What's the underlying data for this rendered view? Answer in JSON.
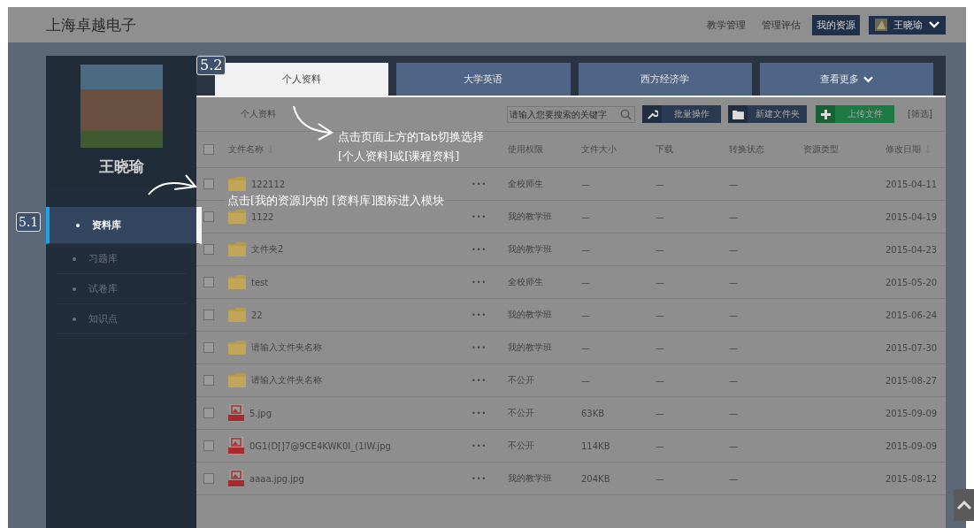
{
  "header": {
    "title": "上海卓越电子",
    "nav": [
      {
        "label": "教学管理",
        "selected": false
      },
      {
        "label": "管理评估",
        "selected": false
      },
      {
        "label": "我的资源",
        "selected": true
      }
    ],
    "user": "王晓瑜"
  },
  "sidebar": {
    "name": "王晓瑜",
    "items": [
      {
        "label": "资料库",
        "selected": true
      },
      {
        "label": "习题库",
        "selected": false
      },
      {
        "label": "试卷库",
        "selected": false
      },
      {
        "label": "知识点",
        "selected": false
      }
    ]
  },
  "tabs": [
    {
      "label": "个人资料",
      "selected": true,
      "kind": "tab"
    },
    {
      "label": "大学英语",
      "selected": false,
      "kind": "tab"
    },
    {
      "label": "西方经济学",
      "selected": false,
      "kind": "tab"
    },
    {
      "label": "查看更多",
      "selected": false,
      "kind": "more"
    }
  ],
  "toolbar": {
    "breadcrumb": "个人资料",
    "search": {
      "placeholder": "请输入您要搜索的关键字"
    },
    "buttons": [
      {
        "label": "批量操作",
        "kind": "batch"
      },
      {
        "label": "新建文件夹",
        "kind": "folder"
      },
      {
        "label": "上传文件",
        "kind": "upload"
      }
    ],
    "filter": "[筛选]"
  },
  "table": {
    "select_all": {
      "checked": false
    },
    "columns": [
      {
        "label": "文件名称",
        "sortable": true
      },
      {
        "label": "使用权限",
        "sortable": false
      },
      {
        "label": "文件大小",
        "sortable": false
      },
      {
        "label": "下载",
        "sortable": false
      },
      {
        "label": "转换状态",
        "sortable": false
      },
      {
        "label": "资源类型",
        "sortable": false
      },
      {
        "label": "修改日期",
        "sortable": true
      }
    ],
    "rows": [
      {
        "name": "122112",
        "kind": "folder",
        "checked": false,
        "menu": "•••",
        "access": "全校师生",
        "size": "—",
        "download": "—",
        "convert": "—",
        "date": "2015-04-11"
      },
      {
        "name": "1122",
        "kind": "folder",
        "checked": false,
        "menu": "•••",
        "access": "我的教学班",
        "size": "—",
        "download": "—",
        "convert": "—",
        "date": "2015-04-19"
      },
      {
        "name": "文件夹2",
        "kind": "folder",
        "checked": false,
        "menu": "•••",
        "access": "我的教学班",
        "size": "—",
        "download": "—",
        "convert": "—",
        "date": "2015-04-23"
      },
      {
        "name": "test",
        "kind": "folder",
        "checked": false,
        "menu": "•••",
        "access": "全校师生",
        "size": "—",
        "download": "—",
        "convert": "—",
        "date": "2015-05-20"
      },
      {
        "name": "22",
        "kind": "folder",
        "checked": false,
        "menu": "•••",
        "access": "我的教学班",
        "size": "—",
        "download": "—",
        "convert": "—",
        "date": "2015-06-24"
      },
      {
        "name": "请输入文件夹名称",
        "kind": "folder",
        "checked": false,
        "menu": "•••",
        "access": "我的教学班",
        "size": "—",
        "download": "—",
        "convert": "—",
        "date": "2015-07-30"
      },
      {
        "name": "请输入文件夹名称",
        "kind": "folder",
        "checked": false,
        "menu": "•••",
        "access": "不公开",
        "size": "—",
        "download": "—",
        "convert": "—",
        "date": "2015-08-27"
      },
      {
        "name": "5.jpg",
        "kind": "jpg",
        "checked": false,
        "menu": "•••",
        "access": "不公开",
        "size": "63KB",
        "download": "—",
        "convert": "—",
        "date": "2015-09-09"
      },
      {
        "name": "0G1(D[]7@9CE4KWK0I_(1IW.jpg",
        "kind": "jpg",
        "checked": false,
        "menu": "•••",
        "access": "不公开",
        "size": "114KB",
        "download": "—",
        "convert": "—",
        "date": "2015-09-09"
      },
      {
        "name": "aaaa.jpg.jpg",
        "kind": "jpg",
        "checked": false,
        "menu": "•••",
        "access": "我的教学班",
        "size": "204KB",
        "download": "—",
        "convert": "—",
        "date": "2015-08-12"
      }
    ]
  },
  "callouts": [
    {
      "kind": "tabs",
      "number": "5.2",
      "lines": [
        "点击页面上方的Tab切换选择",
        "[个人资料]或[课程资料]"
      ]
    },
    {
      "kind": "sidebar",
      "number": "5.1",
      "lines": [
        "点击[我的资源]内的 [资料库]图标进入模块"
      ]
    }
  ]
}
